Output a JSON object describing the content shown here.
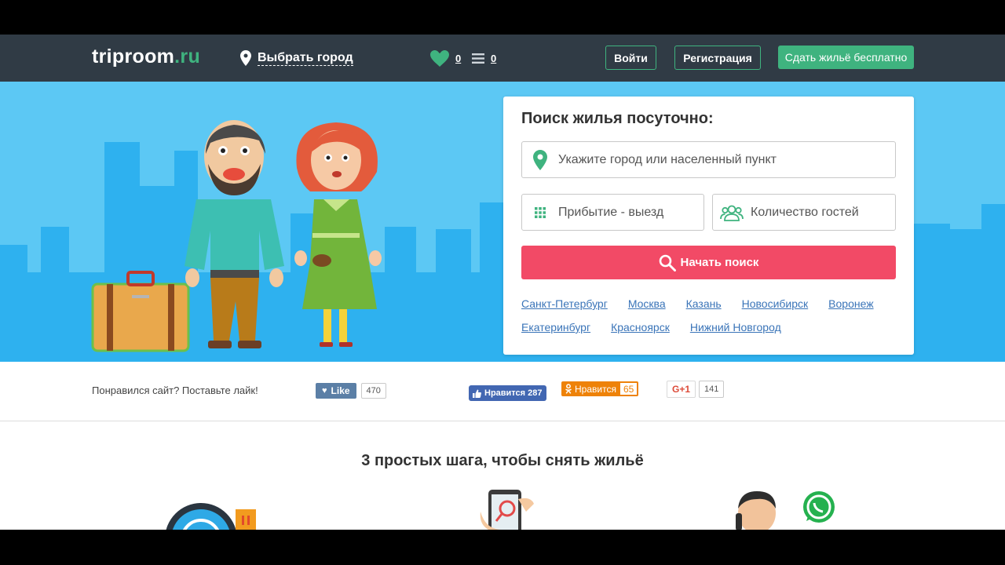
{
  "header": {
    "logo_main": "triproom",
    "logo_tld": ".ru",
    "city_select": "Выбрать город",
    "favorites_count": "0",
    "list_count": "0",
    "login": "Войти",
    "register": "Регистрация",
    "rent_free": "Сдать жильё бесплатно"
  },
  "search": {
    "title": "Поиск жилья посуточно:",
    "city_placeholder": "Укажите город или населенный пункт",
    "dates_placeholder": "Прибытие - выезд",
    "guests_placeholder": "Количество гостей",
    "submit": "Начать поиск",
    "popular_cities_row1": [
      "Санкт-Петербург",
      "Москва",
      "Казань",
      "Новосибирск",
      "Воронеж"
    ],
    "popular_cities_row2": [
      "Екатеринбург",
      "Красноярск",
      "Нижний Новгород"
    ]
  },
  "social": {
    "prompt": "Понравился сайт? Поставьте лайк!",
    "vk_label": "Like",
    "vk_count": "470",
    "fb_label": "Нравится 287",
    "ok_label": "Нравится",
    "ok_count": "65",
    "gplus_label": "G+1",
    "gplus_count": "141"
  },
  "steps": {
    "title": "3 простых шага, чтобы снять жильё"
  },
  "colors": {
    "header_bg": "#303b45",
    "accent_green": "#3fb37f",
    "hero_bg": "#5cc8f4",
    "search_button": "#f24a66",
    "link_blue": "#3a74b8"
  },
  "icons": {
    "city_select": "map-pin-icon",
    "favorites": "heart-icon",
    "list": "list-icon",
    "city_field": "location-pin-icon",
    "dates_field": "calendar-grid-icon",
    "guests_field": "people-icon",
    "search": "search-icon"
  }
}
